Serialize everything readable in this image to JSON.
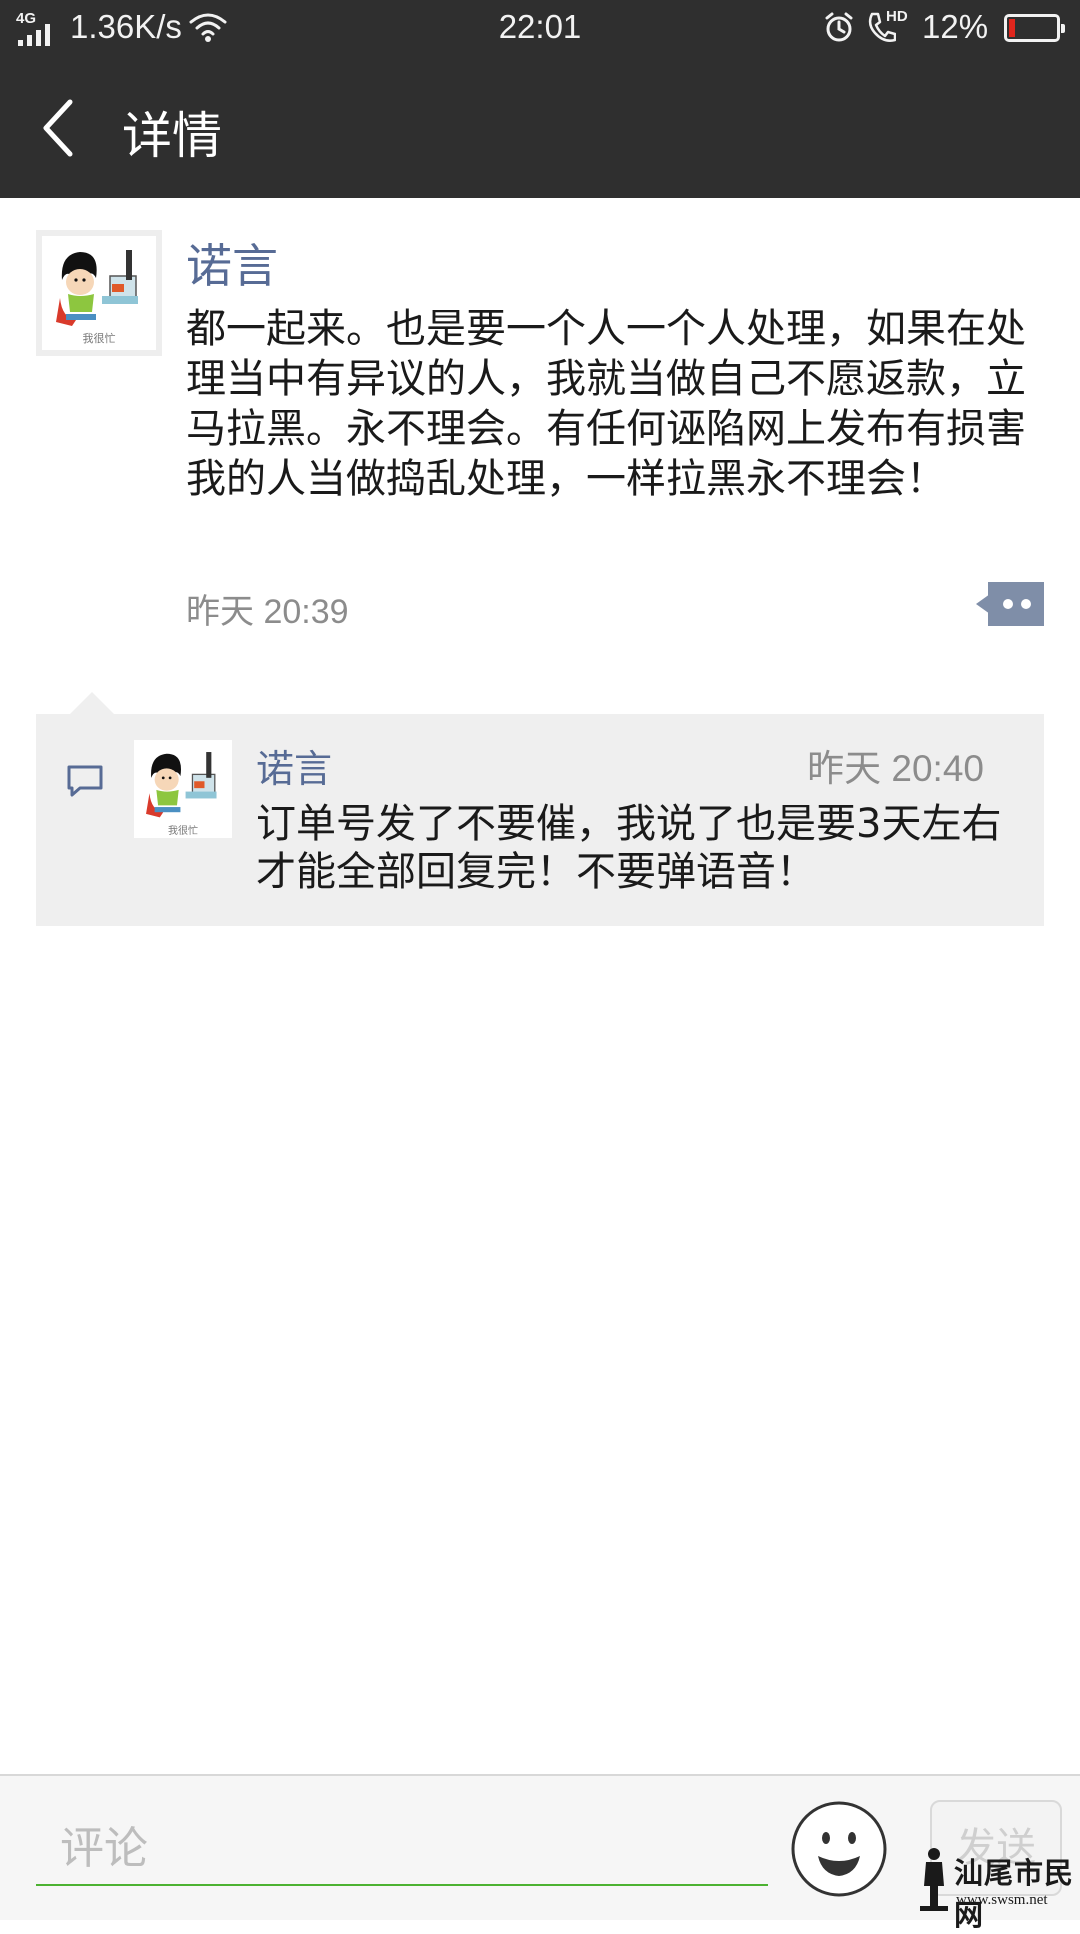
{
  "status_bar": {
    "network": "4G",
    "speed": "1.36K/s",
    "time": "22:01",
    "hd_label": "HD",
    "battery_pct": "12%",
    "battery_level": 0.12,
    "battery_color": "#e0261d"
  },
  "header": {
    "title": "详情",
    "back_icon": "chevron-left-icon"
  },
  "post": {
    "author": "诺言",
    "avatar_caption": "我很忙",
    "body": "都一起来。也是要一个人一个人处理，如果在处理当中有异议的人，我就当做自己不愿返款，立马拉黑。永不理会。有任何诬陷网上发布有损害我的人当做捣乱处理，一样拉黑永不理会！",
    "time": "昨天 20:39",
    "more_icon": "more-dots-icon"
  },
  "comments": [
    {
      "author": "诺言",
      "avatar_caption": "我很忙",
      "time": "昨天 20:40",
      "text": "订单号发了不要催，我说了也是要3天左右才能全部回复完！不要弹语音！"
    }
  ],
  "input_bar": {
    "placeholder": "评论",
    "send_label": "发送",
    "emoji_icon": "smiley-icon",
    "accent_color": "#4cb232"
  },
  "watermark": {
    "name": "汕尾市民网",
    "url": "www.swsm.net"
  },
  "colors": {
    "header_bg": "#2f2f2f",
    "author_link": "#576b95",
    "comment_bg": "#efefef"
  }
}
